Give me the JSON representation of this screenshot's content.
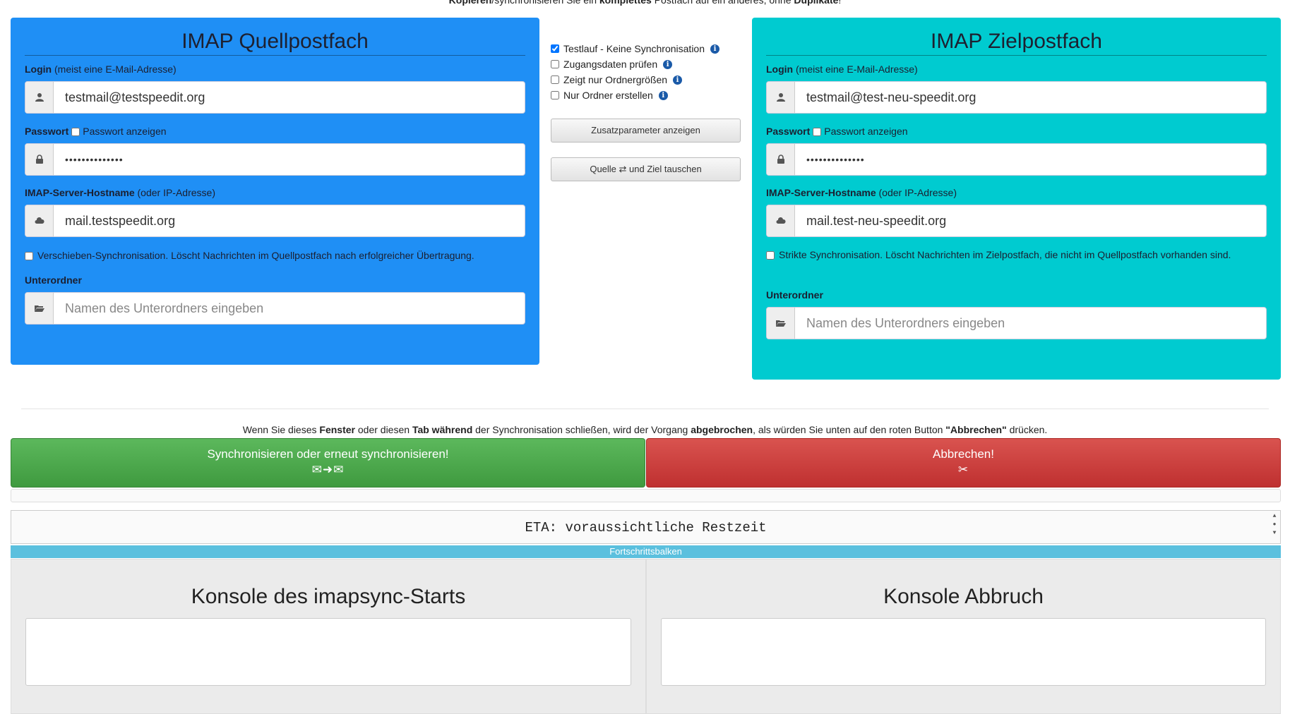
{
  "intro": {
    "part1": "Kopieren",
    "part2": "/synchronisieren Sie ein ",
    "part3": "komplettes",
    "part4": " Postfach auf ein anderes, ohne ",
    "part5": "Duplikate",
    "part6": "!"
  },
  "source": {
    "title": "IMAP Quellpostfach",
    "login_label": "Login",
    "login_hint": "(meist eine E-Mail-Adresse)",
    "login_value": "testmail@testspeedit.org",
    "password_label": "Passwort",
    "show_password_label": "Passwort anzeigen",
    "password_value": "••••••••••••••",
    "host_label": "IMAP-Server-Hostname",
    "host_hint": "(oder IP-Adresse)",
    "host_value": "mail.testspeedit.org",
    "move_sync_label": "Verschieben-Synchronisation. Löscht Nachrichten im Quellpostfach nach erfolgreicher Übertragung.",
    "subfolder_label": "Unterordner",
    "subfolder_placeholder": "Namen des Unterordners eingeben",
    "color": "#1f8ff5"
  },
  "target": {
    "title": "IMAP Zielpostfach",
    "login_label": "Login",
    "login_hint": "(meist eine E-Mail-Adresse)",
    "login_value": "testmail@test-neu-speedit.org",
    "password_label": "Passwort",
    "show_password_label": "Passwort anzeigen",
    "password_value": "••••••••••••••",
    "host_label": "IMAP-Server-Hostname",
    "host_hint": "(oder IP-Adresse)",
    "host_value": "mail.test-neu-speedit.org",
    "strict_sync_label": "Strikte Synchronisation. Löscht Nachrichten im Zielpostfach, die nicht im Quellpostfach vorhanden sind.",
    "subfolder_label": "Unterordner",
    "subfolder_placeholder": "Namen des Unterordners eingeben",
    "color": "#00cbd0"
  },
  "options": [
    {
      "label": "Testlauf - Keine Synchronisation",
      "checked": true
    },
    {
      "label": "Zugangsdaten prüfen",
      "checked": false
    },
    {
      "label": "Zeigt nur Ordnergrößen",
      "checked": false
    },
    {
      "label": "Nur Ordner erstellen",
      "checked": false
    }
  ],
  "buttons": {
    "extra_params": "Zusatzparameter anzeigen",
    "swap_part1": "Quelle ",
    "swap_icon": "⇄",
    "swap_part2": " und Ziel tauschen",
    "sync": "Synchronisieren oder erneut synchronisieren!",
    "sync_icons": "✉➜✉",
    "abort": "Abbrechen!",
    "abort_icon": "✂"
  },
  "warning": {
    "p1": "Wenn Sie dieses ",
    "b1": "Fenster",
    "p2": " oder diesen ",
    "b2": "Tab während",
    "p3": " der Synchronisation schließen, wird der Vorgang ",
    "b3": "abgebrochen",
    "p4": ", als würden Sie unten auf den roten Button ",
    "b4": "\"Abbrechen\"",
    "p5": " drücken."
  },
  "eta": "ETA: voraussichtliche Restzeit",
  "progress": {
    "label": "Fortschrittsbalken",
    "percent": 100
  },
  "consoles": {
    "start_title": "Konsole des imapsync-Starts",
    "abort_title": "Konsole Abbruch"
  }
}
